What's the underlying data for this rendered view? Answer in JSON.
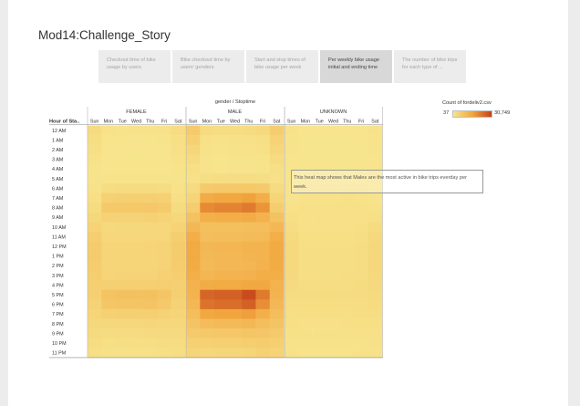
{
  "story": {
    "title": "Mod14:Challenge_Story",
    "points": [
      {
        "label": "Checkout time of bike usage by users",
        "active": false
      },
      {
        "label": "Bike checkout time by users' genders",
        "active": false
      },
      {
        "label": "Start and stop times of bike usage per week",
        "active": false
      },
      {
        "label": "Per weekly bike usage initial and ending time",
        "active": true
      },
      {
        "label": "The number of bike trips for each type of ...",
        "active": false
      }
    ]
  },
  "legend": {
    "title": "Count of fordeliv2.csv",
    "min": "37",
    "max": "30,749",
    "colors": [
      "#f7e58d",
      "#f2a63e",
      "#c5401a"
    ]
  },
  "annotation": {
    "text": "This heat map shows that Males are the most active in bike trips everday per week."
  },
  "chart_data": {
    "type": "heatmap",
    "column_header": "gender / Stoptime",
    "row_header": "Hour of Sta..",
    "genders": [
      "FEMALE",
      "MALE",
      "UNKNOWN"
    ],
    "days": [
      "Sun",
      "Mon",
      "Tue",
      "Wed",
      "Thu",
      "Fri",
      "Sat"
    ],
    "hours": [
      "12 AM",
      "1 AM",
      "2 AM",
      "3 AM",
      "4 AM",
      "5 AM",
      "6 AM",
      "7 AM",
      "8 AM",
      "9 AM",
      "10 AM",
      "11 AM",
      "12 PM",
      "1 PM",
      "2 PM",
      "3 PM",
      "4 PM",
      "5 PM",
      "6 PM",
      "7 PM",
      "8 PM",
      "9 PM",
      "10 PM",
      "11 PM"
    ],
    "color_range": [
      37,
      30749
    ],
    "values": {
      "FEMALE": [
        [
          2500,
          800,
          600,
          700,
          700,
          900,
          2200
        ],
        [
          1700,
          400,
          300,
          300,
          400,
          500,
          1500
        ],
        [
          1400,
          300,
          200,
          200,
          250,
          300,
          1200
        ],
        [
          900,
          200,
          150,
          150,
          150,
          200,
          900
        ],
        [
          600,
          200,
          150,
          150,
          150,
          200,
          600
        ],
        [
          500,
          600,
          600,
          600,
          600,
          600,
          500
        ],
        [
          900,
          2200,
          2300,
          2300,
          2300,
          2200,
          900
        ],
        [
          1500,
          5000,
          5200,
          5200,
          5300,
          4800,
          1500
        ],
        [
          2300,
          7000,
          7200,
          7200,
          7300,
          6600,
          2300
        ],
        [
          3300,
          4600,
          4700,
          4700,
          4800,
          4400,
          3300
        ],
        [
          4500,
          3200,
          3300,
          3300,
          3400,
          3400,
          4500
        ],
        [
          5700,
          3400,
          3500,
          3500,
          3600,
          3800,
          5700
        ],
        [
          6200,
          4100,
          4200,
          4200,
          4300,
          4400,
          6200
        ],
        [
          6200,
          4000,
          4100,
          4100,
          4200,
          4400,
          6200
        ],
        [
          6100,
          3900,
          4000,
          4000,
          4100,
          4500,
          6100
        ],
        [
          5700,
          4300,
          4400,
          4400,
          4500,
          4900,
          5700
        ],
        [
          5400,
          5200,
          5400,
          5400,
          5500,
          5700,
          5400
        ],
        [
          5100,
          8400,
          8700,
          8700,
          8900,
          7800,
          5100
        ],
        [
          4600,
          7600,
          7900,
          7900,
          8100,
          6800,
          4600
        ],
        [
          4000,
          5000,
          5200,
          5200,
          5400,
          4700,
          4000
        ],
        [
          3300,
          3300,
          3500,
          3500,
          3600,
          3400,
          3300
        ],
        [
          2700,
          2300,
          2400,
          2400,
          2600,
          2600,
          2700
        ],
        [
          2100,
          1600,
          1700,
          1700,
          1800,
          2000,
          2200
        ],
        [
          1600,
          1000,
          1100,
          1100,
          1300,
          1500,
          1800
        ]
      ],
      "MALE": [
        [
          6500,
          2500,
          2000,
          2200,
          2500,
          3000,
          6000
        ],
        [
          5000,
          1200,
          900,
          1000,
          1200,
          1500,
          4500
        ],
        [
          3800,
          800,
          600,
          700,
          800,
          1000,
          3500
        ],
        [
          2500,
          500,
          400,
          450,
          500,
          600,
          2500
        ],
        [
          1500,
          500,
          400,
          450,
          500,
          600,
          1500
        ],
        [
          1200,
          1800,
          1900,
          1900,
          2000,
          1800,
          1200
        ],
        [
          2500,
          6500,
          7000,
          7000,
          7200,
          6500,
          2500
        ],
        [
          4000,
          14000,
          15000,
          15000,
          16000,
          13500,
          4000
        ],
        [
          6000,
          19500,
          20500,
          20500,
          22000,
          18000,
          6000
        ],
        [
          8500,
          13000,
          13500,
          13500,
          14000,
          12500,
          8500
        ],
        [
          11000,
          9000,
          9300,
          9300,
          9600,
          9500,
          11000
        ],
        [
          13500,
          9500,
          9800,
          9800,
          10200,
          10500,
          13500
        ],
        [
          14500,
          11000,
          11500,
          11500,
          12000,
          12000,
          14500
        ],
        [
          14500,
          10800,
          11200,
          11200,
          11700,
          12000,
          14500
        ],
        [
          14000,
          10500,
          11000,
          11000,
          11500,
          12500,
          14000
        ],
        [
          13500,
          11500,
          12000,
          12000,
          12500,
          13500,
          13500
        ],
        [
          12500,
          14000,
          14500,
          14500,
          15000,
          15000,
          12500
        ],
        [
          12000,
          25000,
          26000,
          26000,
          29000,
          22000,
          12000
        ],
        [
          11000,
          23000,
          24000,
          24000,
          26000,
          19000,
          11000
        ],
        [
          9500,
          15000,
          15500,
          15500,
          16500,
          13000,
          9500
        ],
        [
          8000,
          10000,
          10500,
          10500,
          11000,
          9500,
          8000
        ],
        [
          6500,
          7000,
          7300,
          7300,
          7800,
          7500,
          6500
        ],
        [
          5000,
          5000,
          5200,
          5200,
          5600,
          6000,
          5500
        ],
        [
          4000,
          3500,
          3700,
          3700,
          4000,
          5000,
          4500
        ]
      ],
      "UNKNOWN": [
        [
          700,
          300,
          250,
          250,
          300,
          400,
          700
        ],
        [
          550,
          150,
          120,
          130,
          150,
          200,
          550
        ],
        [
          450,
          120,
          100,
          100,
          110,
          150,
          450
        ],
        [
          300,
          80,
          60,
          60,
          70,
          100,
          300
        ],
        [
          200,
          80,
          60,
          60,
          70,
          100,
          200
        ],
        [
          180,
          200,
          200,
          200,
          200,
          200,
          180
        ],
        [
          300,
          500,
          500,
          500,
          500,
          500,
          300
        ],
        [
          500,
          900,
          900,
          900,
          950,
          900,
          500
        ],
        [
          900,
          1200,
          1250,
          1250,
          1300,
          1200,
          900
        ],
        [
          1500,
          1100,
          1100,
          1100,
          1150,
          1200,
          1600
        ],
        [
          2200,
          1200,
          1200,
          1200,
          1250,
          1400,
          2400
        ],
        [
          2800,
          1500,
          1500,
          1500,
          1550,
          1800,
          3000
        ],
        [
          3100,
          1700,
          1700,
          1700,
          1800,
          2000,
          3300
        ],
        [
          3200,
          1700,
          1700,
          1700,
          1800,
          2000,
          3400
        ],
        [
          3200,
          1700,
          1700,
          1700,
          1800,
          2100,
          3400
        ],
        [
          3000,
          1800,
          1800,
          1800,
          1900,
          2200,
          3200
        ],
        [
          2800,
          2000,
          2000,
          2000,
          2100,
          2300,
          3000
        ],
        [
          2500,
          2300,
          2300,
          2300,
          2400,
          2400,
          2700
        ],
        [
          2200,
          2100,
          2100,
          2100,
          2200,
          2200,
          2400
        ],
        [
          1800,
          1700,
          1700,
          1700,
          1800,
          1900,
          2000
        ],
        [
          1400,
          1300,
          1300,
          1300,
          1400,
          1500,
          1600
        ],
        [
          1100,
          1000,
          1000,
          1000,
          1100,
          1200,
          1300
        ],
        [
          850,
          700,
          700,
          700,
          800,
          900,
          1000
        ],
        [
          650,
          500,
          500,
          500,
          600,
          700,
          800
        ]
      ]
    }
  }
}
